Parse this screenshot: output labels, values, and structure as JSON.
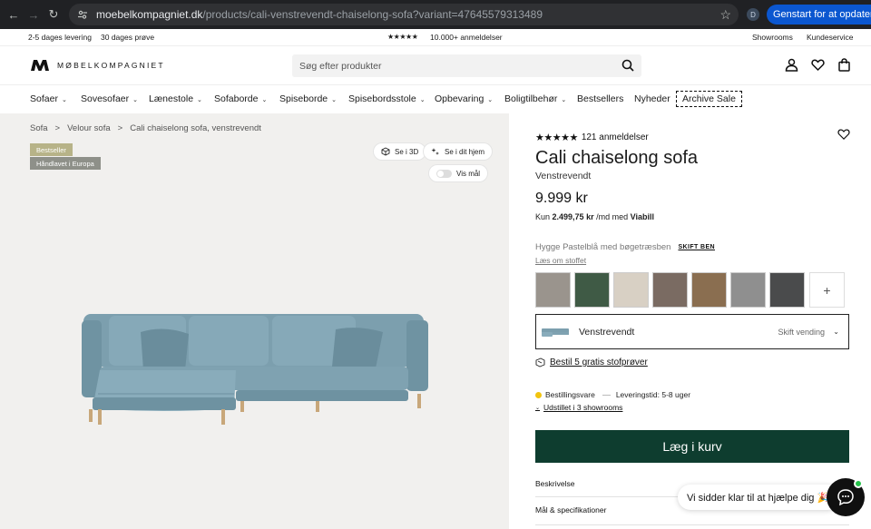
{
  "browser": {
    "url_host": "moebelkompagniet.dk",
    "url_path": "/products/cali-venstrevendt-chaiselong-sofa?variant=47645579313489",
    "profile_initial": "D",
    "update_label": "Genstart for at opdatere"
  },
  "topstrip": {
    "delivery": "2-5 dages levering",
    "trial": "30 dages prøve",
    "rating_stars": "★★★★★",
    "reviews": "10.000+ anmeldelser",
    "showrooms": "Showrooms",
    "service": "Kundeservice"
  },
  "header": {
    "logo_text": "MØBELKOMPAGNIET",
    "search_placeholder": "Søg efter produkter"
  },
  "menu": {
    "items": [
      "Sofaer",
      "Sovesofaer",
      "Lænestole",
      "Sofaborde",
      "Spiseborde",
      "Spisebordsstole",
      "Opbevaring",
      "Boligtilbehør",
      "Bestsellers",
      "Nyheder"
    ],
    "archive": "Archive Sale"
  },
  "gallery": {
    "breadcrumbs": [
      "Sofa",
      "Velour sofa",
      "Cali chaiselong sofa, venstrevendt"
    ],
    "badges": [
      "Bestseller",
      "Håndlavet i Europa"
    ],
    "view_3d": "Se i 3D",
    "view_home": "Se i dit hjem",
    "show_dims": "Vis mål"
  },
  "product": {
    "rating_stars": "★★★★★",
    "reviews": "121 anmeldelser",
    "title": "Cali chaiselong sofa",
    "variant": "Venstrevendt",
    "price": "9.999 kr",
    "finance_prefix": "Kun",
    "finance_amount": "2.499,75 kr",
    "finance_suffix": "/md med",
    "finance_provider": "Viabill",
    "fabric_name": "Hygge Pastelblå med bøgetræsben",
    "change_legs": "SKIFT BEN",
    "read_fabric": "Læs om stoffet",
    "swatch_colors": [
      "#9a948d",
      "#3f5a45",
      "#d8d0c4",
      "#7a6b62",
      "#8a6e50",
      "#8f8f8f",
      "#4a4b4c"
    ],
    "config_label": "Venstrevendt",
    "config_change": "Skift vending",
    "samples": "Bestil 5 gratis stofprøver",
    "stock_status": "Bestillingsvare",
    "delivery_time": "Leveringstid: 5-8 uger",
    "showrooms": "Udstillet i 3 showrooms",
    "cart": "Læg i kurv",
    "accordion": [
      "Beskrivelse",
      "Mål & specifikationer"
    ]
  },
  "chat": {
    "message": "Vi sidder klar til at hjælpe dig 🎉"
  }
}
